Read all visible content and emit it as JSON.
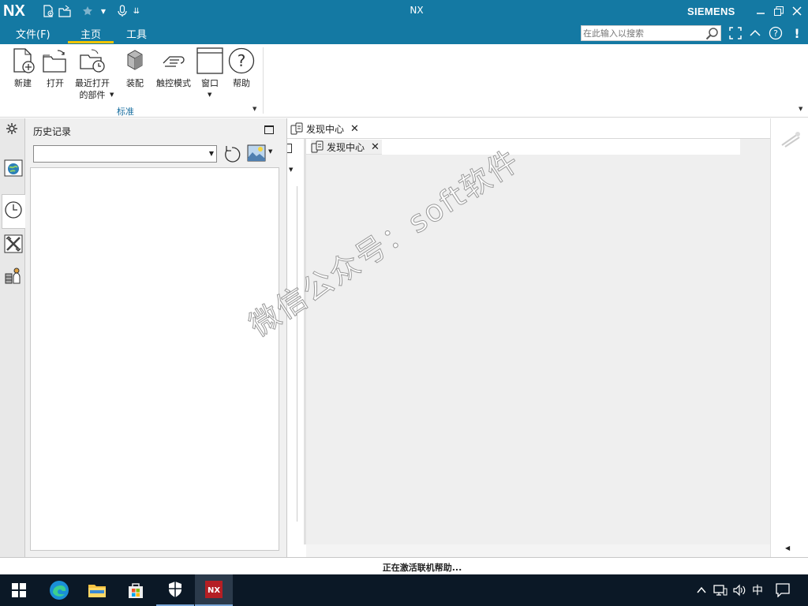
{
  "titlebar": {
    "logo": "NX",
    "title": "NX",
    "brand": "SIEMENS",
    "icons": [
      "new-file-icon",
      "open-file-icon",
      "favorite-star-icon",
      "microphone-icon",
      "quick-access-customize-icon"
    ]
  },
  "menubar": {
    "tabs": [
      "文件(F)",
      "主页",
      "工具"
    ],
    "active_tab": "主页",
    "search_placeholder": "在此输入以搜索"
  },
  "ribbon": {
    "buttons": [
      {
        "label": "新建",
        "icon": "new-document-icon"
      },
      {
        "label": "打开",
        "icon": "open-folder-icon"
      },
      {
        "label": "最近打开",
        "label2": "的部件",
        "icon": "recent-parts-icon"
      },
      {
        "label": "装配",
        "icon": "assembly-icon"
      },
      {
        "label": "触控模式",
        "icon": "touch-mode-icon"
      },
      {
        "label": "窗口",
        "icon": "window-icon"
      },
      {
        "label": "帮助",
        "icon": "help-icon"
      }
    ],
    "group_label": "标准"
  },
  "resource_bar": {
    "icons": [
      "settings-icon",
      "web-browser-icon",
      "history-clock-icon",
      "tools-palette-icon",
      "roles-icon"
    ],
    "active": "history-clock-icon"
  },
  "history_panel": {
    "title": "历史记录",
    "combo_value": ""
  },
  "main": {
    "outer_tab": "发现中心",
    "inner_tab": "发现中心"
  },
  "watermark": "微信公众号：soft软件",
  "status": "正在激活联机帮助...",
  "taskbar": {
    "apps": [
      "windows-start-icon",
      "edge-browser-icon",
      "file-explorer-icon",
      "microsoft-store-icon",
      "windows-security-icon",
      "nx-app-icon"
    ],
    "ime": "中"
  },
  "colors": {
    "titlebar": "#1479a3",
    "accent": "#f2c500",
    "taskbar": "#0b1826"
  }
}
